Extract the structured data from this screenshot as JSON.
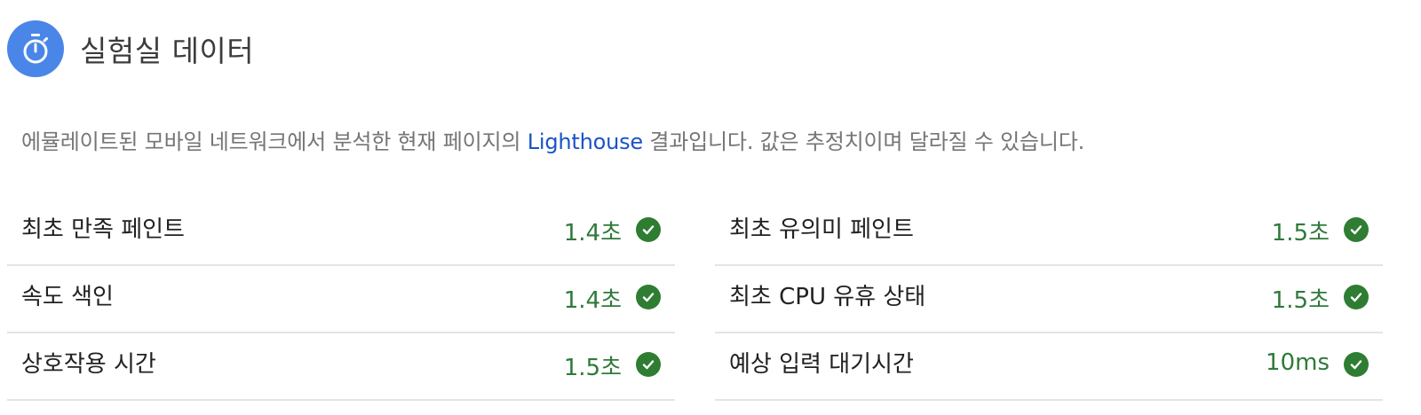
{
  "header": {
    "title": "실험실 데이터",
    "icon": "stopwatch-icon",
    "icon_bg": "#4a86e8"
  },
  "description": {
    "prefix": "에뮬레이트된 모바일 네트워크에서 분석한 현재 페이지의 ",
    "link": "Lighthouse",
    "suffix": " 결과입니다. 값은 추정치이며 달라질 수 있습니다."
  },
  "metrics": {
    "left": [
      {
        "label": "최초 만족 페인트",
        "value": "1.4초",
        "status": "pass"
      },
      {
        "label": "속도 색인",
        "value": "1.4초",
        "status": "pass"
      },
      {
        "label": "상호작용 시간",
        "value": "1.5초",
        "status": "pass"
      }
    ],
    "right": [
      {
        "label": "최초 유의미 페인트",
        "value": "1.5초",
        "status": "pass"
      },
      {
        "label": "최초 CPU 유휴 상태",
        "value": "1.5초",
        "status": "pass"
      },
      {
        "label": "예상 입력 대기시간",
        "value": "10ms",
        "status": "pass"
      }
    ]
  },
  "colors": {
    "pass": "#2e7d32",
    "link": "#1a53c7"
  }
}
